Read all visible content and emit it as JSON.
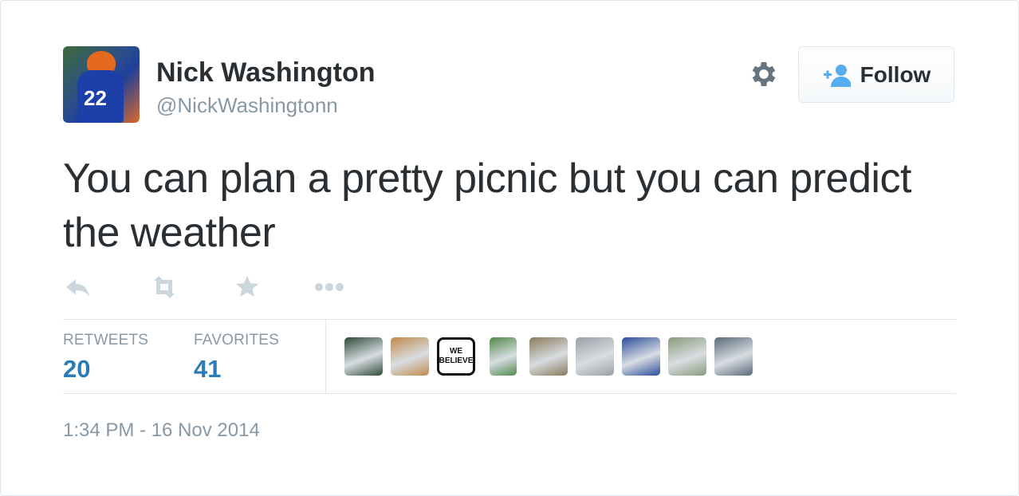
{
  "user": {
    "name": "Nick Washington",
    "handle": "@NickWashingtonn",
    "avatar_number": "22"
  },
  "follow_button": {
    "label": "Follow"
  },
  "tweet": {
    "text": "You can plan a pretty picnic but you can predict the weather"
  },
  "actions": [
    {
      "name": "reply",
      "icon": "reply-icon"
    },
    {
      "name": "retweet",
      "icon": "retweet-icon"
    },
    {
      "name": "favorite",
      "icon": "star-icon"
    },
    {
      "name": "more",
      "icon": "more-icon"
    }
  ],
  "stats": {
    "retweets_label": "RETWEETS",
    "retweets_value": "20",
    "favorites_label": "FAVORITES",
    "favorites_value": "41"
  },
  "favoriters": {
    "badge_line1": "WE",
    "badge_line2": "BELIEVE",
    "avatar_colors": [
      "#2f4a3a",
      "#c08a4a",
      "#ffffff",
      "#4f8a4a",
      "#8a7a5a",
      "#9aa0a6",
      "#2a4c9a",
      "#8a9a7a",
      "#5a6a7a"
    ]
  },
  "timestamp": "1:34 PM - 16 Nov 2014",
  "colors": {
    "text": "#292f33",
    "muted": "#8899a6",
    "stat_value": "#2b7bb9",
    "follow_icon": "#55acee",
    "border": "#e1e8ed"
  }
}
